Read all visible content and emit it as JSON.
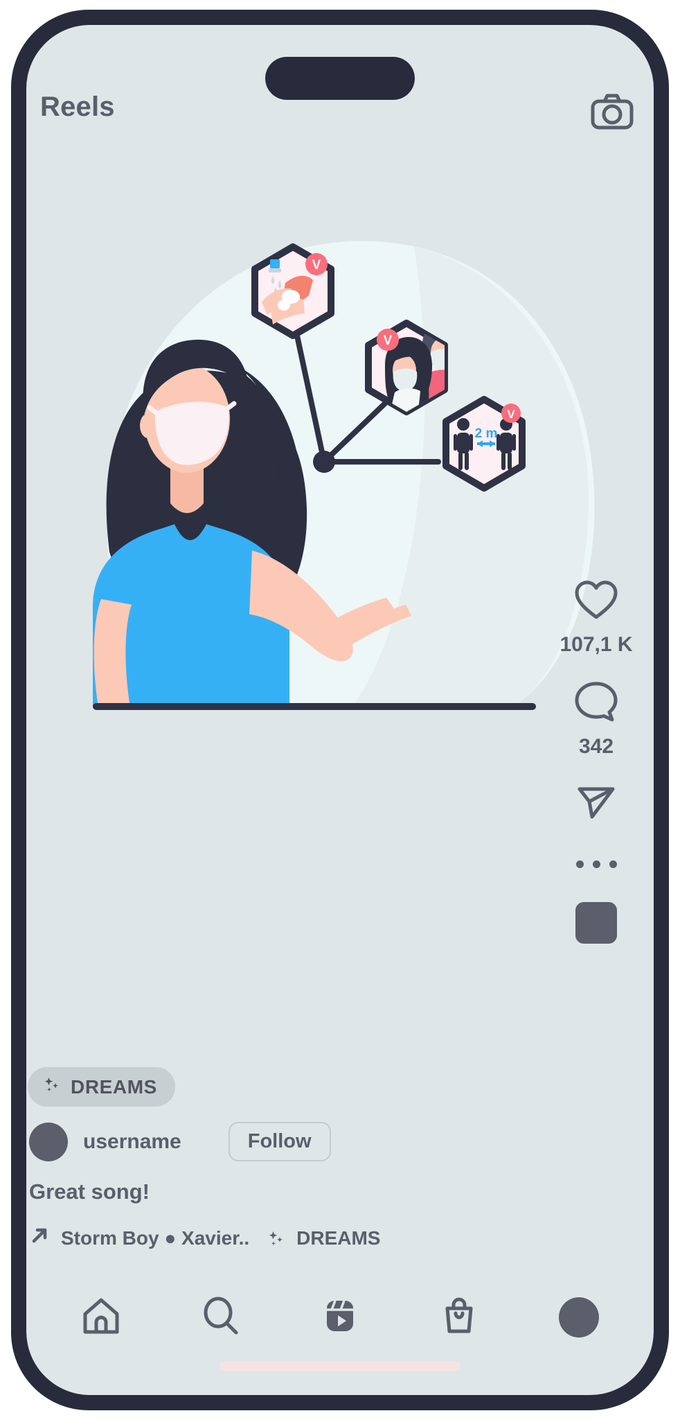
{
  "app": {
    "screen_title": "Reels"
  },
  "header": {
    "title": "Reels",
    "camera_icon": "camera-icon"
  },
  "media": {
    "description": "Illustration of a masked woman pointing at three hexagon COVID-19 prevention badges",
    "badges": [
      {
        "id": "handwash",
        "label": "V",
        "topic": "wash-hands"
      },
      {
        "id": "wear-mask",
        "label": "V",
        "topic": "wear-mask"
      },
      {
        "id": "distance",
        "label": "V",
        "topic": "social-distance",
        "distance_text": "2 m"
      }
    ],
    "colors": {
      "screen_bg": "#dee6e7",
      "blob": "#eef7f8",
      "shirt": "#36b0f5",
      "skin": "#fcc9b6",
      "hair": "#2b2f40",
      "outline": "#2e3244",
      "badge_pink": "#fb6d7c",
      "badge_bg": "#fdeff4",
      "accent_blue": "#30a8f0"
    }
  },
  "actions": {
    "like": {
      "icon": "heart-icon",
      "count": "107,1 K"
    },
    "comment": {
      "icon": "comment-icon",
      "count": "342"
    },
    "share": {
      "icon": "send-icon"
    },
    "more": {
      "icon": "more-options-icon"
    },
    "album": {
      "icon": "album-thumbnail"
    }
  },
  "meta": {
    "audio_pill": {
      "icon": "sparkle-icon",
      "label": "DREAMS"
    },
    "username": "username",
    "follow_label": "Follow",
    "caption": "Great song!",
    "music": {
      "icon": "arrow-up-right-icon",
      "title": "Storm Boy ● Xavier..",
      "sparkle_icon": "sparkle-icon",
      "audio_name": "DREAMS"
    }
  },
  "bottom_nav": {
    "items": [
      {
        "name": "home",
        "icon": "home-icon"
      },
      {
        "name": "search",
        "icon": "search-icon"
      },
      {
        "name": "reels",
        "icon": "reels-icon"
      },
      {
        "name": "shop",
        "icon": "shopping-bag-icon"
      },
      {
        "name": "profile",
        "icon": "profile-avatar-icon"
      }
    ]
  }
}
